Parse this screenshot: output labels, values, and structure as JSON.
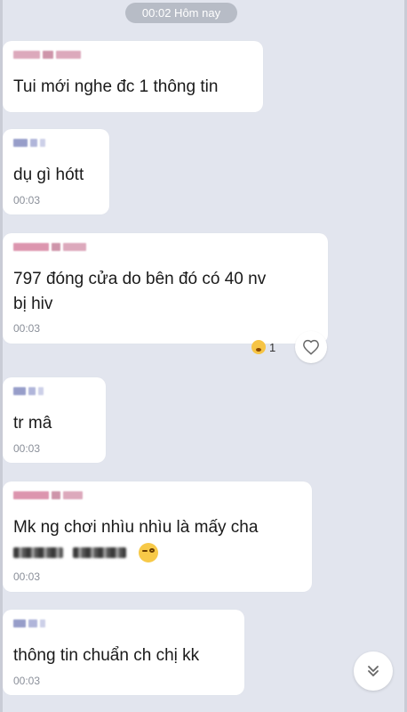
{
  "time_divider": "00:02 Hôm nay",
  "messages": [
    {
      "text": "Tui mới nghe đc 1 thông tin",
      "time": ""
    },
    {
      "text": "dụ gì hótt",
      "time": "00:03"
    },
    {
      "text_lines": [
        "797 đóng cửa do bên đó có 40 nv",
        "bị hiv"
      ],
      "time": "00:03",
      "reaction_count": "1"
    },
    {
      "text": "tr mâ",
      "time": "00:03"
    },
    {
      "text_line1": "Mk ng chơi nhìu nhìu là mấy cha",
      "time": "00:03"
    },
    {
      "text": "thông tin chuẩn ch chị kk",
      "time": "00:03"
    }
  ],
  "icons": {
    "like": "heart-icon",
    "scroll": "chevron-double-down-icon",
    "reaction": "flushed-face-emoji",
    "inline_emoji": "smirk-face-emoji"
  },
  "colors": {
    "background": "#e2e5ee",
    "bubble": "#ffffff",
    "time_pill": "#b7bcc6",
    "meta_text": "#8a8f99"
  }
}
